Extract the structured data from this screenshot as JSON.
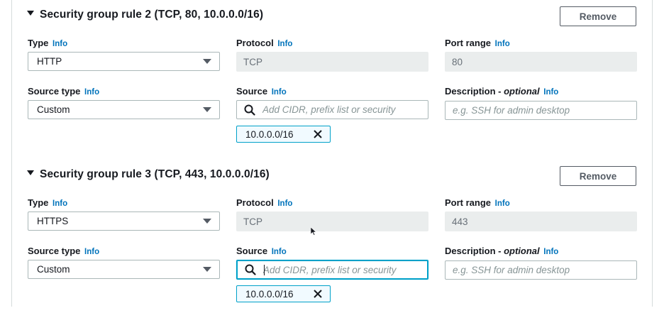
{
  "rules": [
    {
      "title": "Security group rule 2 (TCP, 80, 10.0.0.0/16)",
      "remove_label": "Remove",
      "type": {
        "label": "Type",
        "info": "Info",
        "value": "HTTP"
      },
      "protocol": {
        "label": "Protocol",
        "info": "Info",
        "value": "TCP"
      },
      "port_range": {
        "label": "Port range",
        "info": "Info",
        "value": "80"
      },
      "source_type": {
        "label": "Source type",
        "info": "Info",
        "value": "Custom"
      },
      "source": {
        "label": "Source",
        "info": "Info",
        "placeholder": "Add CIDR, prefix list or security",
        "focused": false
      },
      "description": {
        "label": "Description - ",
        "optional": "optional",
        "info": "Info",
        "placeholder": "e.g. SSH for admin desktop"
      },
      "token": "10.0.0.0/16"
    },
    {
      "title": "Security group rule 3 (TCP, 443, 10.0.0.0/16)",
      "remove_label": "Remove",
      "type": {
        "label": "Type",
        "info": "Info",
        "value": "HTTPS"
      },
      "protocol": {
        "label": "Protocol",
        "info": "Info",
        "value": "TCP"
      },
      "port_range": {
        "label": "Port range",
        "info": "Info",
        "value": "443"
      },
      "source_type": {
        "label": "Source type",
        "info": "Info",
        "value": "Custom"
      },
      "source": {
        "label": "Source",
        "info": "Info",
        "placeholder": "Add CIDR, prefix list or security",
        "focused": true
      },
      "description": {
        "label": "Description - ",
        "optional": "optional",
        "info": "Info",
        "placeholder": "e.g. SSH for admin desktop"
      },
      "token": "10.0.0.0/16"
    }
  ],
  "colors": {
    "info_link": "#0073bb",
    "focus_border": "#00a1c9",
    "token_bg": "#f1faff",
    "readonly_bg": "#eaeded"
  },
  "icons": [
    "caret-down-icon",
    "dropdown-arrow-icon",
    "search-icon",
    "close-icon"
  ]
}
